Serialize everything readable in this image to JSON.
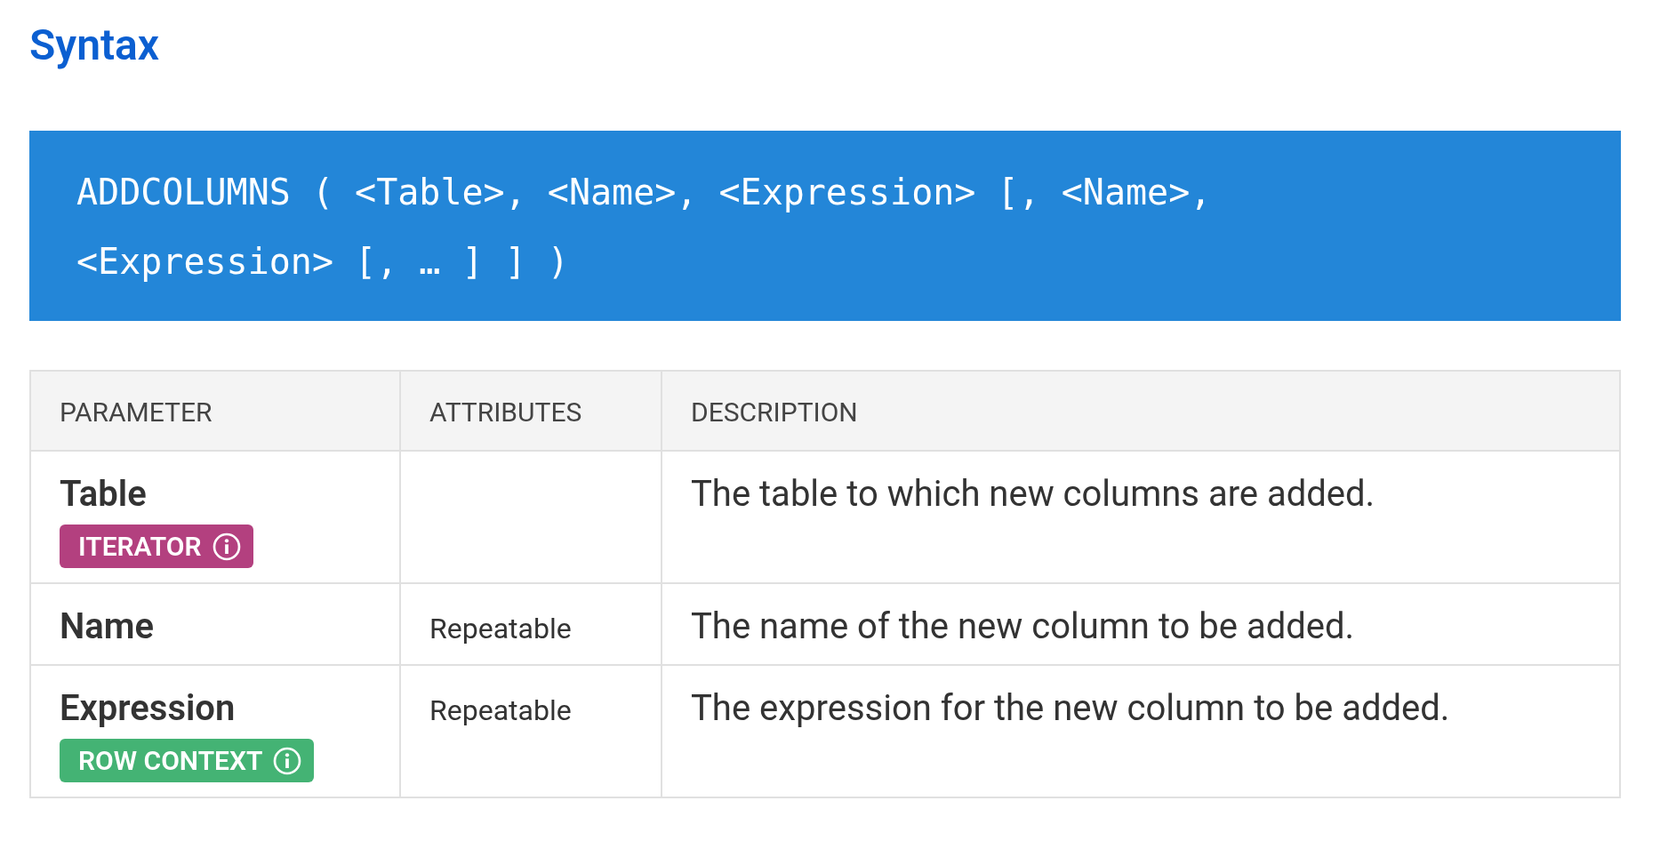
{
  "heading": "Syntax",
  "code": "ADDCOLUMNS ( <Table>, <Name>, <Expression> [, <Name>, <Expression> [, … ] ] )",
  "table": {
    "columns": [
      "PARAMETER",
      "ATTRIBUTES",
      "DESCRIPTION"
    ],
    "rows": [
      {
        "parameter": "Table",
        "badge": {
          "label": "ITERATOR",
          "color": "#b3407f"
        },
        "description": "The table to which new columns are added."
      },
      {
        "parameter": "Name",
        "attributes": "Repeatable",
        "description": "The name of the new column to be added."
      },
      {
        "parameter": "Expression",
        "badge": {
          "label": "ROW CONTEXT",
          "color": "#44b374"
        },
        "attributes": "Repeatable",
        "description": "The expression for the new column to be added."
      }
    ]
  }
}
